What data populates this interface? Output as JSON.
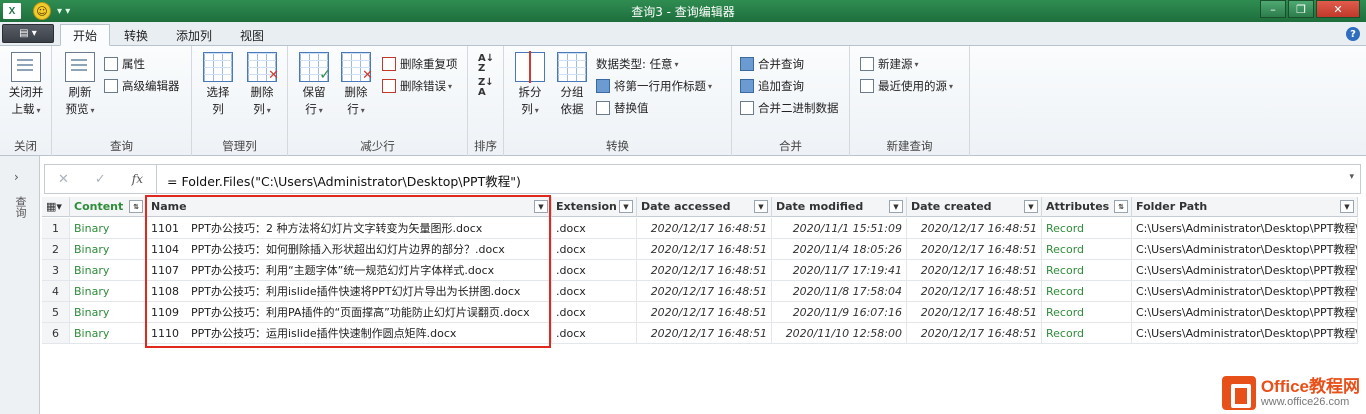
{
  "window": {
    "title": "查询3 - 查询编辑器",
    "app_badge": "X",
    "quick_access": "▾ ▾"
  },
  "tabs": [
    {
      "label": "开始",
      "active": true
    },
    {
      "label": "转换"
    },
    {
      "label": "添加列"
    },
    {
      "label": "视图"
    }
  ],
  "ribbon": {
    "close": {
      "btn": "关闭并\n上载",
      "btn_l1": "关闭并",
      "btn_l2": "上载",
      "group": "关闭"
    },
    "query": {
      "refresh_l1": "刷新",
      "refresh_l2": "预览",
      "properties": "属性",
      "advanced_editor": "高级编辑器",
      "group": "查询"
    },
    "manage_cols": {
      "choose_l1": "选择",
      "choose_l2": "列",
      "remove_l1": "删除",
      "remove_l2": "列",
      "group": "管理列"
    },
    "reduce_rows": {
      "keep_l1": "保留",
      "keep_l2": "行",
      "remove_l1": "删除",
      "remove_l2": "行",
      "remove_duplicates": "删除重复项",
      "remove_errors": "删除错误",
      "group": "减少行"
    },
    "sort": {
      "group": "排序"
    },
    "transform": {
      "split_l1": "拆分",
      "split_l2": "列",
      "groupby_l1": "分组",
      "groupby_l2": "依据",
      "data_type": "数据类型: 任意",
      "first_row_header": "将第一行用作标题",
      "replace_values": "替换值",
      "group": "转换"
    },
    "combine": {
      "merge": "合并查询",
      "append": "追加查询",
      "combine_binaries": "合并二进制数据",
      "group": "合并"
    },
    "new_query": {
      "new_source": "新建源",
      "recent_sources": "最近使用的源",
      "group": "新建查询"
    }
  },
  "left_pane": {
    "label": "查询"
  },
  "formula_bar": {
    "cancel": "✕",
    "commit": "✓",
    "fx": "fx",
    "formula": "= Folder.Files(\"C:\\Users\\Administrator\\Desktop\\PPT教程\")"
  },
  "table": {
    "columns": [
      "Content",
      "Name",
      "Extension",
      "Date accessed",
      "Date modified",
      "Date created",
      "Attributes",
      "Folder Path"
    ],
    "rows": [
      {
        "n": "1",
        "content": "Binary",
        "num": "1101",
        "title": "PPT办公技巧：2 种方法将幻灯片文字转变为矢量图形.docx",
        "ext": ".docx",
        "accessed": "2020/12/17 16:48:51",
        "modified": "2020/11/1 15:51:09",
        "created": "2020/12/17 16:48:51",
        "attr": "Record",
        "path": "C:\\Users\\Administrator\\Desktop\\PPT教程\\"
      },
      {
        "n": "2",
        "content": "Binary",
        "num": "1104",
        "title": "PPT办公技巧：如何删除插入形状超出幻灯片边界的部分？.docx",
        "ext": ".docx",
        "accessed": "2020/12/17 16:48:51",
        "modified": "2020/11/4 18:05:26",
        "created": "2020/12/17 16:48:51",
        "attr": "Record",
        "path": "C:\\Users\\Administrator\\Desktop\\PPT教程\\"
      },
      {
        "n": "3",
        "content": "Binary",
        "num": "1107",
        "title": "PPT办公技巧：利用“主题字体”统一规范幻灯片字体样式.docx",
        "ext": ".docx",
        "accessed": "2020/12/17 16:48:51",
        "modified": "2020/11/7 17:19:41",
        "created": "2020/12/17 16:48:51",
        "attr": "Record",
        "path": "C:\\Users\\Administrator\\Desktop\\PPT教程\\"
      },
      {
        "n": "4",
        "content": "Binary",
        "num": "1108",
        "title": "PPT办公技巧：利用islide插件快速将PPT幻灯片导出为长拼图.docx",
        "ext": ".docx",
        "accessed": "2020/12/17 16:48:51",
        "modified": "2020/11/8 17:58:04",
        "created": "2020/12/17 16:48:51",
        "attr": "Record",
        "path": "C:\\Users\\Administrator\\Desktop\\PPT教程\\"
      },
      {
        "n": "5",
        "content": "Binary",
        "num": "1109",
        "title": "PPT办公技巧：利用PA插件的“页面撑高”功能防止幻灯片误翻页.docx",
        "ext": ".docx",
        "accessed": "2020/12/17 16:48:51",
        "modified": "2020/11/9 16:07:16",
        "created": "2020/12/17 16:48:51",
        "attr": "Record",
        "path": "C:\\Users\\Administrator\\Desktop\\PPT教程\\"
      },
      {
        "n": "6",
        "content": "Binary",
        "num": "1110",
        "title": "PPT办公技巧：运用islide插件快速制作圆点矩阵.docx",
        "ext": ".docx",
        "accessed": "2020/12/17 16:48:51",
        "modified": "2020/11/10 12:58:00",
        "created": "2020/12/17 16:48:51",
        "attr": "Record",
        "path": "C:\\Users\\Administrator\\Desktop\\PPT教程\\"
      }
    ]
  },
  "watermark": {
    "brand": "Office教程网",
    "url": "www.office26.com"
  },
  "colors": {
    "title_bar": "#217346",
    "highlight_box": "#e0281e",
    "content_green": "#2e8c3a",
    "watermark_orange": "#e8501a"
  }
}
